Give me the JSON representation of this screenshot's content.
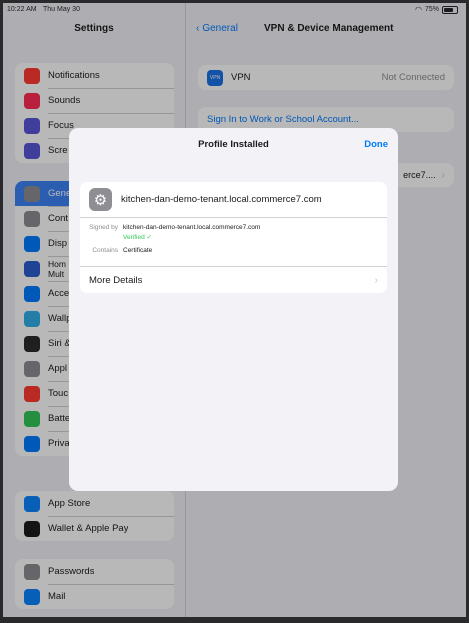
{
  "status_bar": {
    "time": "10:22 AM",
    "date": "Thu May 30",
    "battery": "75%"
  },
  "sidebar": {
    "title": "Settings",
    "groups": [
      [
        {
          "label": "Notifications",
          "icon": "bell-icon",
          "color": "#ff3b30"
        },
        {
          "label": "Sounds",
          "icon": "speaker-icon",
          "color": "#ff2d55"
        },
        {
          "label": "Focus",
          "icon": "moon-icon",
          "color": "#5856d6"
        },
        {
          "label": "Scre",
          "icon": "hourglass-icon",
          "color": "#5856d6"
        }
      ],
      [
        {
          "label": "Gene",
          "icon": "gear-icon",
          "color": "#8e8e93",
          "selected": true
        },
        {
          "label": "Cont",
          "icon": "toggles-icon",
          "color": "#8e8e93"
        },
        {
          "label": "Disp",
          "icon": "text-size-icon",
          "color": "#007aff"
        },
        {
          "label": "Hom\nMult",
          "icon": "grid-icon",
          "color": "#2c5fcc"
        },
        {
          "label": "Acce",
          "icon": "accessibility-icon",
          "color": "#007aff"
        },
        {
          "label": "Wallp",
          "icon": "flower-icon",
          "color": "#32ade6"
        },
        {
          "label": "Siri &",
          "icon": "siri-icon",
          "color": "#2b2b2b"
        },
        {
          "label": "Appl",
          "icon": "pencil-icon",
          "color": "#8e8e93"
        },
        {
          "label": "Touc",
          "icon": "fingerprint-icon",
          "color": "#ff3b30"
        },
        {
          "label": "Batte",
          "icon": "battery-icon",
          "color": "#34c759"
        },
        {
          "label": "Priva",
          "icon": "hand-icon",
          "color": "#007aff"
        }
      ],
      [
        {
          "label": "App Store",
          "icon": "app-store-icon",
          "color": "#0a84ff"
        },
        {
          "label": "Wallet & Apple Pay",
          "icon": "wallet-icon",
          "color": "#1c1c1e"
        }
      ],
      [
        {
          "label": "Passwords",
          "icon": "key-icon",
          "color": "#8e8e93"
        },
        {
          "label": "Mail",
          "icon": "mail-icon",
          "color": "#0a84ff"
        }
      ]
    ]
  },
  "detail": {
    "back_label": "General",
    "title": "VPN & Device Management",
    "vpn": {
      "badge": "VPN",
      "label": "VPN",
      "status": "Not Connected"
    },
    "signin_label": "Sign In to Work or School Account...",
    "mdm_label": "erce7...."
  },
  "modal": {
    "title": "Profile Installed",
    "done_label": "Done",
    "profile_name": "kitchen-dan-demo-tenant.local.commerce7.com",
    "signed_by_key": "Signed by",
    "signed_by_value": "kitchen-dan-demo-tenant.local.commerce7.com",
    "verified": "Verified ✓",
    "contains_key": "Contains",
    "contains_value": "Certificate",
    "more_details": "More Details"
  }
}
